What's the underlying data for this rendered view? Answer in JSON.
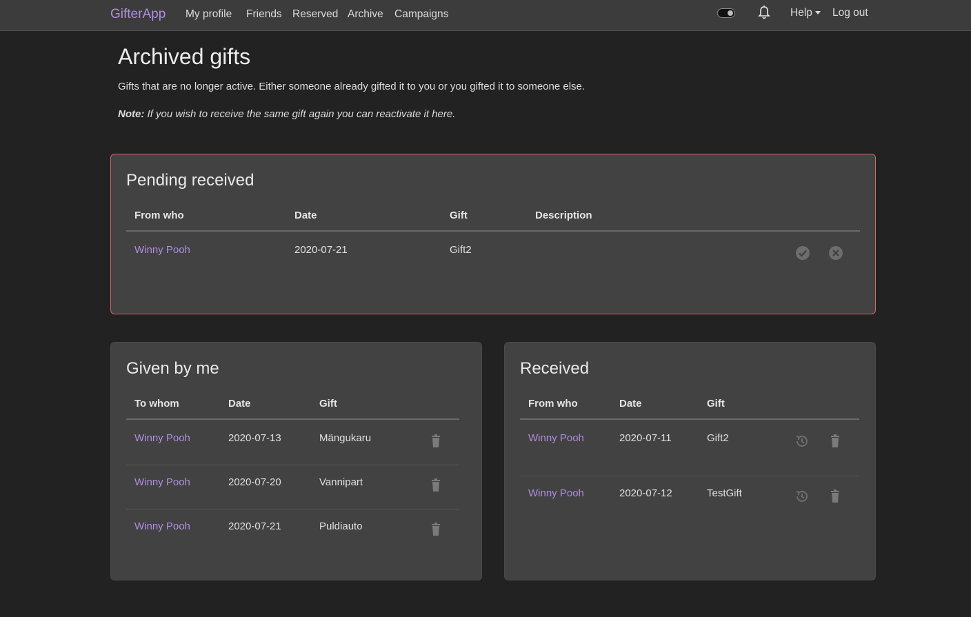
{
  "nav": {
    "brand": "GifterApp",
    "links": [
      "My profile",
      "Friends",
      "Reserved",
      "Archive",
      "Campaigns"
    ],
    "help": "Help",
    "logout": "Log out"
  },
  "header": {
    "title": "Archived gifts",
    "intro": "Gifts that are no longer active. Either someone already gifted it to you or you gifted it to someone else.",
    "note_label": "Note:",
    "note_text": " If you wish to receive the same gift again you can reactivate it here."
  },
  "pending": {
    "title": "Pending received",
    "columns": [
      "From who",
      "Date",
      "Gift",
      "Description"
    ],
    "rows": [
      {
        "from": "Winny Pooh",
        "date": "2020-07-21",
        "gift": "Gift2",
        "description": ""
      }
    ]
  },
  "given": {
    "title": "Given by me",
    "columns": [
      "To whom",
      "Date",
      "Gift"
    ],
    "rows": [
      {
        "to": "Winny Pooh",
        "date": "2020-07-13",
        "gift": "Mängukaru"
      },
      {
        "to": "Winny Pooh",
        "date": "2020-07-20",
        "gift": "Vannipart"
      },
      {
        "to": "Winny Pooh",
        "date": "2020-07-21",
        "gift": "Puldiauto"
      }
    ]
  },
  "received": {
    "title": "Received",
    "columns": [
      "From who",
      "Date",
      "Gift"
    ],
    "rows": [
      {
        "from": "Winny Pooh",
        "date": "2020-07-11",
        "gift": "Gift2"
      },
      {
        "from": "Winny Pooh",
        "date": "2020-07-12",
        "gift": "TestGift"
      }
    ]
  },
  "colors": {
    "accent": "#b08ee0",
    "background": "#222222",
    "card": "#424242",
    "pending_border": "#d9646a"
  }
}
